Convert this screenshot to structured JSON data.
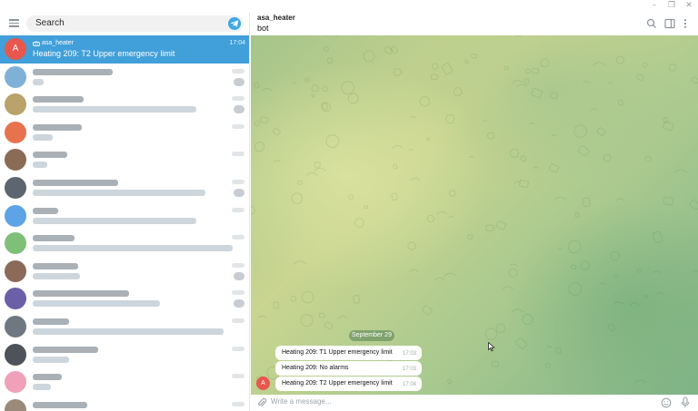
{
  "window": {
    "minimize_glyph": "–",
    "maximize_glyph": "❐",
    "close_glyph": "✕"
  },
  "sidebar": {
    "search_placeholder": "Search",
    "active_chat": {
      "avatar_letter": "A",
      "avatar_color": "#e8574d",
      "name": "asa_heater",
      "bot_icon": "bot-icon",
      "time": "17:04",
      "preview": "Heating 209: T2 Upper emergency limit",
      "highlight_color": "#419fd9"
    },
    "blurred_chats": [
      {
        "avatar_color": "#7fb0d8"
      },
      {
        "avatar_color": "#b9a26b"
      },
      {
        "avatar_color": "#e7734e"
      },
      {
        "avatar_color": "#8a6b55"
      },
      {
        "avatar_color": "#5c6570"
      },
      {
        "avatar_color": "#5da3e6"
      },
      {
        "avatar_color": "#7fc078"
      },
      {
        "avatar_color": "#8b6a5a"
      },
      {
        "avatar_color": "#6b5fa8"
      },
      {
        "avatar_color": "#6f7880"
      },
      {
        "avatar_color": "#4d5359"
      },
      {
        "avatar_color": "#f0a0b8"
      },
      {
        "avatar_color": "#9a8a7a"
      }
    ]
  },
  "chat": {
    "peer_name": "asa_heater",
    "peer_status": "bot",
    "date_separator": "September 29",
    "sender_avatar_letter": "A",
    "messages": [
      {
        "text": "Heating 209: T1 Upper emergency limit",
        "time": "17:03"
      },
      {
        "text": "Heating 209: No alarms",
        "time": "17:03"
      },
      {
        "text": "Heating 209: T2 Upper emergency limit",
        "time": "17:04"
      }
    ],
    "composer_placeholder": "Write a message...",
    "header_icons": [
      "search-icon",
      "sidebar-toggle-icon",
      "more-vertical-icon"
    ],
    "composer_icons": [
      "paperclip-icon",
      "emoji-icon",
      "microphone-icon"
    ]
  }
}
